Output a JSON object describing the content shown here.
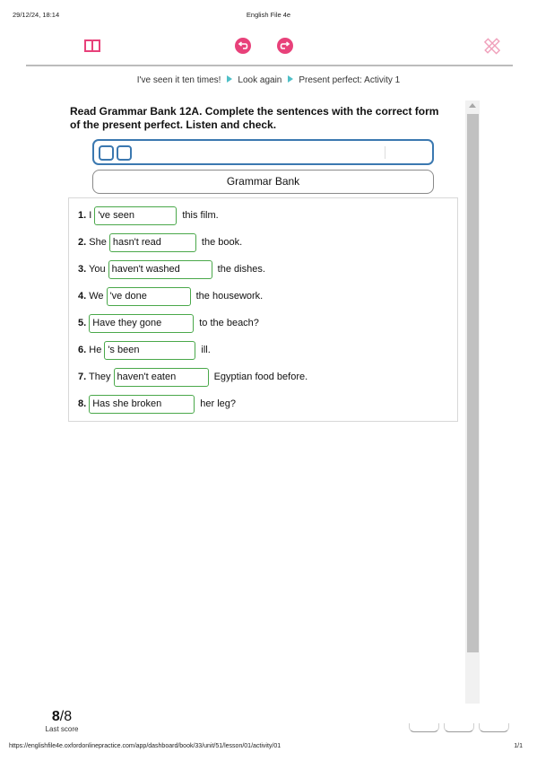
{
  "print_header": {
    "date": "29/12/24, 18:14",
    "title": "English File 4e"
  },
  "toolbar": {
    "book_icon": "book-icon",
    "undo_icon": "undo-icon",
    "redo_icon": "redo-icon",
    "tools_icon": "pencil-ruler-icon",
    "accent_color": "#e8417a"
  },
  "breadcrumb": [
    "I've seen it ten times!",
    "Look again",
    "Present perfect: Activity 1"
  ],
  "instruction": "Read Grammar Bank 12A. Complete the sentences with the correct form of the present perfect. Listen and check.",
  "grammar_bank_label": "Grammar Bank",
  "items": [
    {
      "num": "1.",
      "pre": "I",
      "answer": "'ve seen",
      "post": "this film."
    },
    {
      "num": "2.",
      "pre": "She",
      "answer": "hasn't read",
      "post": "the book."
    },
    {
      "num": "3.",
      "pre": "You",
      "answer": "haven't washed",
      "post": "the dishes."
    },
    {
      "num": "4.",
      "pre": "We",
      "answer": "'ve done",
      "post": "the housework."
    },
    {
      "num": "5.",
      "pre": "",
      "answer": "Have they gone",
      "post": "to the beach?"
    },
    {
      "num": "6.",
      "pre": "He",
      "answer": "'s been",
      "post": "ill."
    },
    {
      "num": "7.",
      "pre": "They",
      "answer": "haven't eaten",
      "post": "Egyptian food before."
    },
    {
      "num": "8.",
      "pre": "",
      "answer": "Has she broken",
      "post": "her leg?"
    }
  ],
  "score": {
    "value": "8",
    "total": "/8",
    "label": "Last score"
  },
  "print_footer": {
    "url": "https://englishfile4e.oxfordonlinepractice.com/app/dashboard/book/33/unit/51/lesson/01/activity/01",
    "page": "1/1"
  }
}
